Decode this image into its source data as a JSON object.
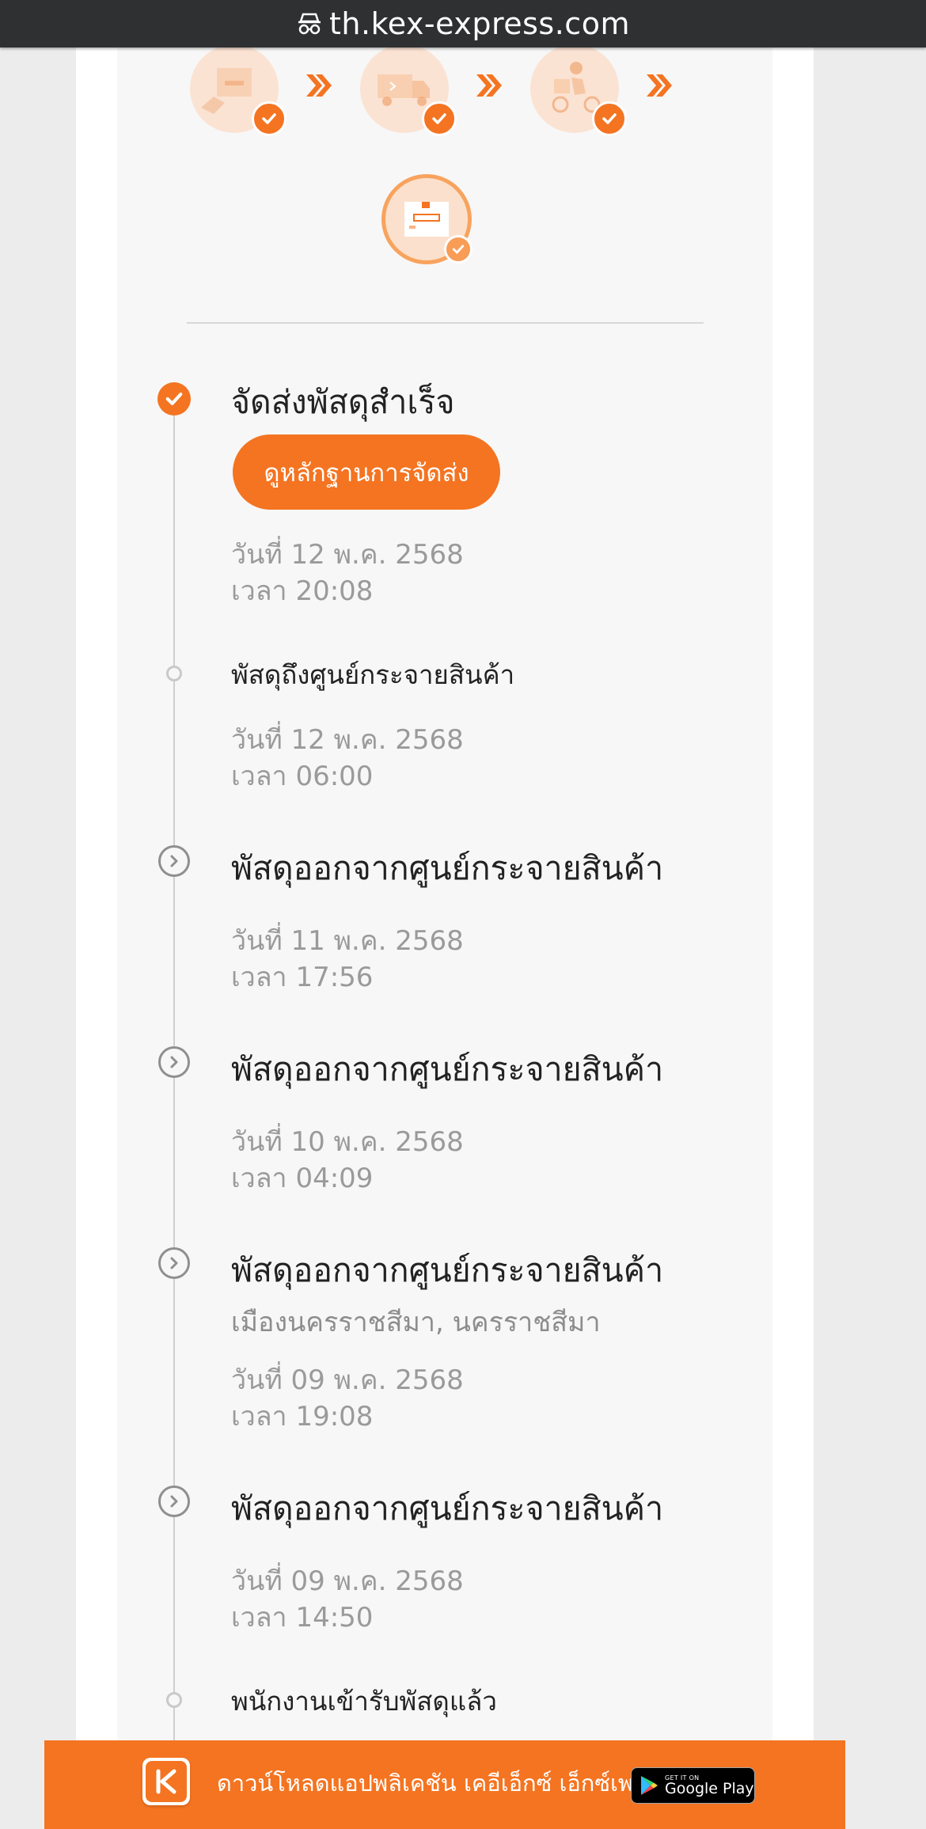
{
  "browser": {
    "url": "th.kex-express.com",
    "icon": "incognito-icon"
  },
  "progress_steps": [
    {
      "icon": "parcel-received-icon",
      "status_icon": "check-icon"
    },
    {
      "icon": "delivery-truck-icon",
      "status_icon": "check-icon"
    },
    {
      "icon": "delivery-rider-icon",
      "status_icon": "check-icon"
    },
    {
      "icon": "parcel-delivered-icon",
      "status_icon": "check-icon"
    }
  ],
  "timeline": {
    "events": [
      {
        "title": "จัดส่งพัสดุสำเร็จ",
        "button": "ดูหลักฐานการจัดส่ง",
        "date": "วันที่ 12 พ.ค. 2568",
        "time": "เวลา 20:08",
        "marker": "check"
      },
      {
        "title": "พัสดุถึงศูนย์กระจายสินค้า",
        "date": "วันที่ 12 พ.ค. 2568",
        "time": "เวลา 06:00",
        "marker": "dot"
      },
      {
        "title": "พัสดุออกจากศูนย์กระจายสินค้า",
        "date": "วันที่ 11 พ.ค. 2568",
        "time": "เวลา 17:56",
        "marker": "arrow"
      },
      {
        "title": "พัสดุออกจากศูนย์กระจายสินค้า",
        "date": "วันที่ 10 พ.ค. 2568",
        "time": "เวลา 04:09",
        "marker": "arrow"
      },
      {
        "title": "พัสดุออกจากศูนย์กระจายสินค้า",
        "location": "เมืองนครราชสีมา, นครราชสีมา",
        "date": "วันที่ 09 พ.ค. 2568",
        "time": "เวลา 19:08",
        "marker": "arrow"
      },
      {
        "title": "พัสดุออกจากศูนย์กระจายสินค้า",
        "date": "วันที่ 09 พ.ค. 2568",
        "time": "เวลา 14:50",
        "marker": "arrow"
      },
      {
        "title": "พนักงานเข้ารับพัสดุแล้ว",
        "marker": "dot"
      }
    ]
  },
  "app_banner": {
    "text": "ดาวน์โหลดแอปพลิเคชัน เคอีเอ็กซ์ เอ็กซ์เพรส",
    "store_small": "GET IT ON",
    "store_big": "Google Play"
  },
  "colors": {
    "accent": "#f47421",
    "card_bg": "#f7f7f7",
    "urlbar_bg": "#2f3032"
  }
}
